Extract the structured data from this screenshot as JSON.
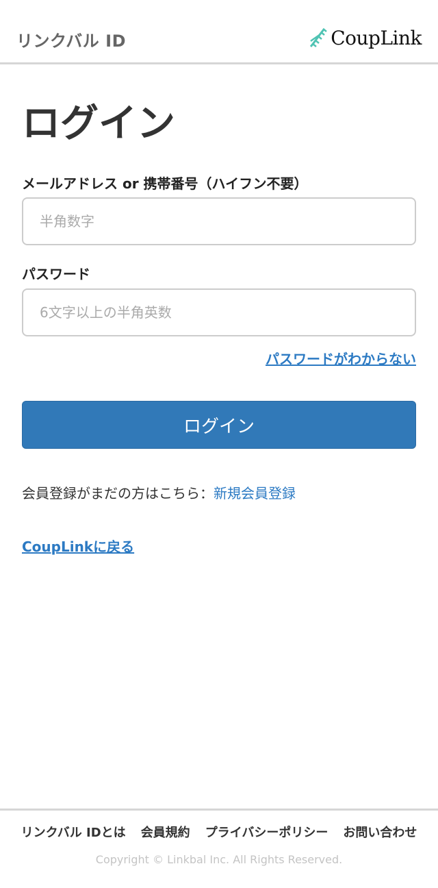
{
  "header": {
    "brand": "リンクバル ID",
    "logo_text": "CoupLink",
    "logo_color": "#4fc3b3"
  },
  "main": {
    "title": "ログイン",
    "email_label": "メールアドレス or 携帯番号（ハイフン不要）",
    "email_placeholder": "半角数字",
    "email_value": "",
    "password_label": "パスワード",
    "password_placeholder": "6文字以上の半角英数",
    "password_value": "",
    "forgot_link": "パスワードがわからない",
    "login_button": "ログイン",
    "register_text": "会員登録がまだの方はこちら：",
    "register_link": "新規会員登録",
    "back_link": "CoupLinkに戻る"
  },
  "footer": {
    "links": [
      "リンクバル IDとは",
      "会員規約",
      "プライバシーポリシー",
      "お問い合わせ"
    ],
    "copyright": "Copyright © Linkbal Inc. All Rights Reserved."
  },
  "colors": {
    "accent": "#3179b8",
    "link": "#2c7ac3"
  }
}
